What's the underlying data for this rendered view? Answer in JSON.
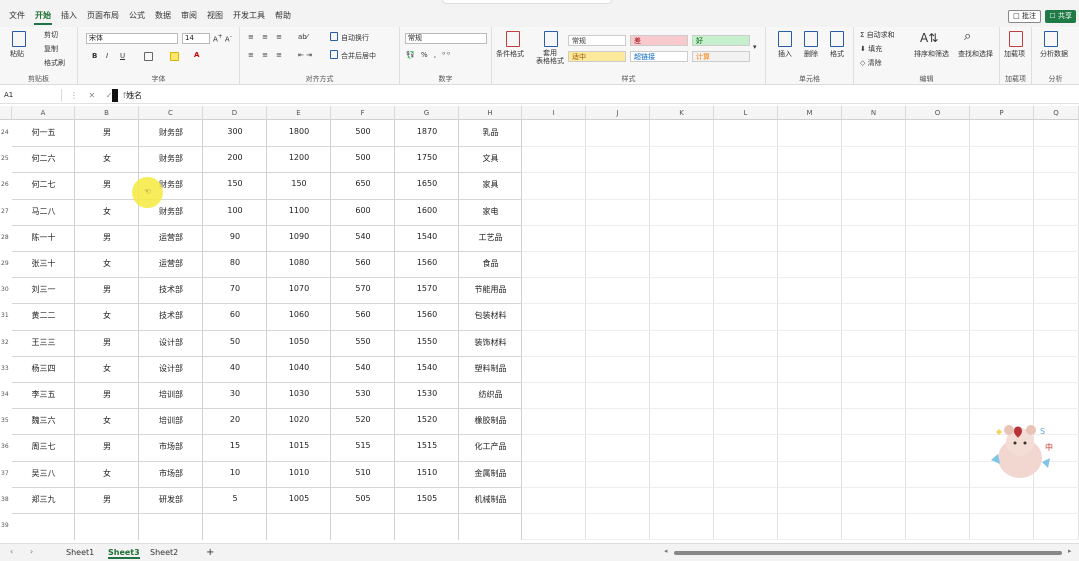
{
  "menu": [
    "文件",
    "开始",
    "插入",
    "页面布局",
    "公式",
    "数据",
    "审阅",
    "视图",
    "开发工具",
    "帮助"
  ],
  "menu_active_index": 1,
  "topbar": {
    "comment_label": "□ 批注",
    "share_label": "☐ 共享"
  },
  "ribbon": {
    "clipboard": {
      "label": "剪贴板",
      "paste": "粘贴",
      "cut": "剪切",
      "copy": "复制",
      "format_painter": "格式刷"
    },
    "font": {
      "label": "字体",
      "font_name": "宋体",
      "font_size": "14",
      "bold": "B",
      "italic": "I",
      "underline": "U"
    },
    "alignment": {
      "label": "对齐方式",
      "wrap_text": "自动换行",
      "merge_center": "合并后居中"
    },
    "number": {
      "label": "数字",
      "format": "常规"
    },
    "styles": {
      "label": "样式",
      "conditional": "条件格式",
      "table": "套用\n表格格式",
      "cells": [
        {
          "text": "常规",
          "bg": "#ffffff",
          "color": "#333333"
        },
        {
          "text": "差",
          "bg": "#f8c9cd",
          "color": "#9c0006"
        },
        {
          "text": "好",
          "bg": "#c6efce",
          "color": "#006100"
        },
        {
          "text": "适中",
          "bg": "#fde99c",
          "color": "#9c5700"
        },
        {
          "text": "超链接",
          "bg": "#ffffff",
          "color": "#0563c1"
        },
        {
          "text": "计算",
          "bg": "#f2f2f2",
          "color": "#fa7d00"
        }
      ]
    },
    "cells": {
      "label": "单元格",
      "insert": "插入",
      "delete": "删除",
      "format": "格式"
    },
    "editing": {
      "label": "编辑",
      "autosum": "自动求和",
      "fill": "填充",
      "clear": "清除",
      "sort": "排序和筛选",
      "find": "查找和选择"
    },
    "addins": {
      "label": "加载项",
      "addin": "加载项"
    },
    "analysis": {
      "label": "分析",
      "analyze": "分析数据"
    }
  },
  "formula_bar": {
    "name_box": "A1",
    "controls": "⋮ ✕ ✓ fx",
    "content": "姓名"
  },
  "columns": [
    "A",
    "B",
    "C",
    "D",
    "E",
    "F",
    "G",
    "H",
    "I",
    "J",
    "K",
    "L",
    "M",
    "N",
    "O",
    "P",
    "Q"
  ],
  "rows": [
    {
      "num": "24",
      "cells": [
        "何一五",
        "男",
        "财务部",
        "300",
        "1800",
        "500",
        "1870",
        "乳品"
      ]
    },
    {
      "num": "25",
      "cells": [
        "何二六",
        "女",
        "财务部",
        "200",
        "1200",
        "500",
        "1750",
        "文具"
      ]
    },
    {
      "num": "26",
      "cells": [
        "何二七",
        "男",
        "财务部",
        "150",
        "150",
        "650",
        "1650",
        "家具"
      ]
    },
    {
      "num": "27",
      "cells": [
        "马二八",
        "女",
        "财务部",
        "100",
        "1100",
        "600",
        "1600",
        "家电"
      ]
    },
    {
      "num": "28",
      "cells": [
        "陈一十",
        "男",
        "运营部",
        "90",
        "1090",
        "540",
        "1540",
        "工艺品"
      ]
    },
    {
      "num": "29",
      "cells": [
        "张三十",
        "女",
        "运营部",
        "80",
        "1080",
        "560",
        "1560",
        "食品"
      ]
    },
    {
      "num": "30",
      "cells": [
        "刘三一",
        "男",
        "技术部",
        "70",
        "1070",
        "570",
        "1570",
        "节能用品"
      ]
    },
    {
      "num": "31",
      "cells": [
        "黄二二",
        "女",
        "技术部",
        "60",
        "1060",
        "560",
        "1560",
        "包装材料"
      ]
    },
    {
      "num": "32",
      "cells": [
        "王三三",
        "男",
        "设计部",
        "50",
        "1050",
        "550",
        "1550",
        "装饰材料"
      ]
    },
    {
      "num": "33",
      "cells": [
        "杨三四",
        "女",
        "设计部",
        "40",
        "1040",
        "540",
        "1540",
        "塑料制品"
      ]
    },
    {
      "num": "34",
      "cells": [
        "李三五",
        "男",
        "培训部",
        "30",
        "1030",
        "530",
        "1530",
        "纺织品"
      ]
    },
    {
      "num": "35",
      "cells": [
        "魏三六",
        "女",
        "培训部",
        "20",
        "1020",
        "520",
        "1520",
        "橡胶制品"
      ]
    },
    {
      "num": "36",
      "cells": [
        "周三七",
        "男",
        "市场部",
        "15",
        "1015",
        "515",
        "1515",
        "化工产品"
      ]
    },
    {
      "num": "37",
      "cells": [
        "吴三八",
        "女",
        "市场部",
        "10",
        "1010",
        "510",
        "1510",
        "金属制品"
      ]
    },
    {
      "num": "38",
      "cells": [
        "郑三九",
        "男",
        "研发部",
        "5",
        "1005",
        "505",
        "1505",
        "机械制品"
      ]
    },
    {
      "num": "39",
      "cells": [
        "",
        "",
        "",
        "",
        "",
        "",
        "",
        ""
      ]
    }
  ],
  "sheets": [
    "Sheet1",
    "Sheet3",
    "Sheet2"
  ],
  "active_sheet_index": 1,
  "add_sheet_label": "+",
  "sticker_text": "中",
  "colors": {
    "accent": "#217346",
    "click_highlight": "#f6ea3d"
  }
}
